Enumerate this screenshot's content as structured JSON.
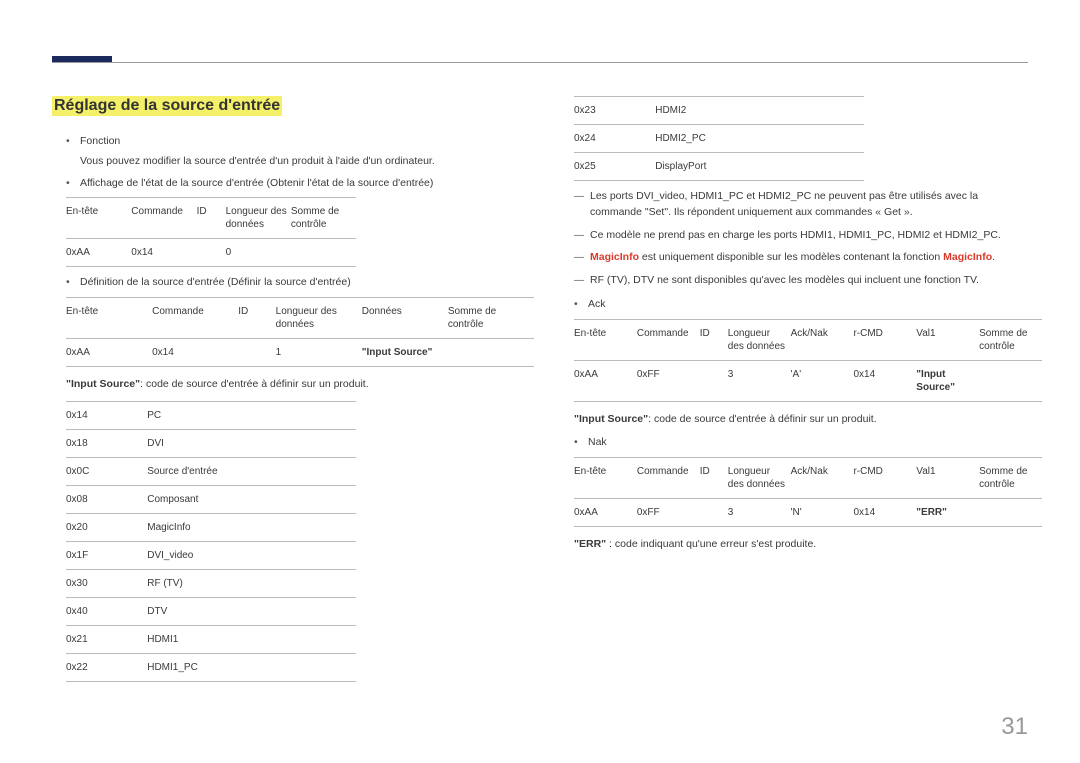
{
  "pageNumber": "31",
  "title": "Réglage de la source d'entrée",
  "left": {
    "bullet1_label": "Fonction",
    "bullet1_desc": "Vous pouvez modifier la source d'entrée d'un produit à l'aide d'un ordinateur.",
    "bullet2": "Affichage de l'état de la source d'entrée (Obtenir l'état de la source d'entrée)",
    "tbl_get": {
      "h1": "En-tête",
      "h2": "Commande",
      "h3": "ID",
      "h4": "Longueur des données",
      "h5": "Somme de contrôle",
      "r1": "0xAA",
      "r2": "0x14",
      "r3": "",
      "r4": "0",
      "r5": ""
    },
    "bullet3": "Définition de la source d'entrée (Définir la source d'entrée)",
    "tbl_set": {
      "h1": "En-tête",
      "h2": "Commande",
      "h3": "ID",
      "h4": "Longueur des données",
      "h5": "Données",
      "h6": "Somme de contrôle",
      "r1": "0xAA",
      "r2": "0x14",
      "r3": "",
      "r4": "1",
      "r5": "\"Input Source\"",
      "r6": ""
    },
    "note_is": "\"Input Source\": code de source d'entrée à définir sur un produit.",
    "codes": [
      {
        "c": "0x14",
        "v": "PC"
      },
      {
        "c": "0x18",
        "v": "DVI"
      },
      {
        "c": "0x0C",
        "v": "Source d'entrée"
      },
      {
        "c": "0x08",
        "v": "Composant"
      },
      {
        "c": "0x20",
        "v": "MagicInfo"
      },
      {
        "c": "0x1F",
        "v": "DVI_video"
      },
      {
        "c": "0x30",
        "v": "RF (TV)"
      },
      {
        "c": "0x40",
        "v": "DTV"
      },
      {
        "c": "0x21",
        "v": "HDMI1"
      },
      {
        "c": "0x22",
        "v": "HDMI1_PC"
      }
    ]
  },
  "right": {
    "codes": [
      {
        "c": "0x23",
        "v": "HDMI2"
      },
      {
        "c": "0x24",
        "v": "HDMI2_PC"
      },
      {
        "c": "0x25",
        "v": "DisplayPort"
      }
    ],
    "dash1": "Les ports DVI_video, HDMI1_PC et HDMI2_PC ne peuvent pas être utilisés avec la commande \"Set\". Ils répondent uniquement aux commandes « Get ».",
    "dash2": "Ce modèle ne prend pas en charge les ports HDMI1, HDMI1_PC, HDMI2 et HDMI2_PC.",
    "dash3_a": "MagicInfo",
    "dash3_b": " est uniquement disponible sur les modèles contenant la fonction ",
    "dash3_c": "MagicInfo",
    "dash3_d": ".",
    "dash4": "RF (TV), DTV ne sont disponibles qu'avec les modèles qui incluent une fonction TV.",
    "ack": "Ack",
    "tbl_ack": {
      "h1": "En-tête",
      "h2": "Commande",
      "h3": "ID",
      "h4": "Longueur des données",
      "h5": "Ack/Nak",
      "h6": "r-CMD",
      "h7": "Val1",
      "h8": "Somme de contrôle",
      "r1": "0xAA",
      "r2": "0xFF",
      "r3": "",
      "r4": "3",
      "r5": "'A'",
      "r6": "0x14",
      "r7": "\"Input Source\"",
      "r8": ""
    },
    "note_is2": "\"Input Source\": code de source d'entrée à définir sur un produit.",
    "nak": "Nak",
    "tbl_nak": {
      "h1": "En-tête",
      "h2": "Commande",
      "h3": "ID",
      "h4": "Longueur des données",
      "h5": "Ack/Nak",
      "h6": "r-CMD",
      "h7": "Val1",
      "h8": "Somme de contrôle",
      "r1": "0xAA",
      "r2": "0xFF",
      "r3": "",
      "r4": "3",
      "r5": "'N'",
      "r6": "0x14",
      "r7": "\"ERR\"",
      "r8": ""
    },
    "err_note_a": "\"ERR\"",
    "err_note_b": " : code indiquant qu'une erreur s'est produite."
  }
}
